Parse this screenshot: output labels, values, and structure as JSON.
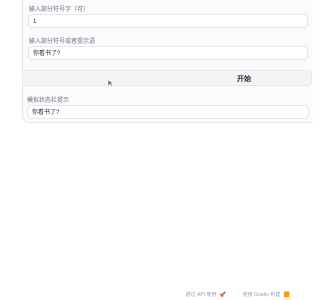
{
  "panel": {
    "field1": {
      "label": "输入部分符号字（可）",
      "value": "1"
    },
    "field2": {
      "label": "输入部分符号或者提示语",
      "value": "你看书了?"
    },
    "start_button": {
      "label": "开始"
    },
    "output": {
      "label": "模拟状态栏提示",
      "value": "你看书了?"
    }
  },
  "footer": {
    "left_text": "通过 API 使用",
    "right_text": "使用 Gradio 构建"
  }
}
